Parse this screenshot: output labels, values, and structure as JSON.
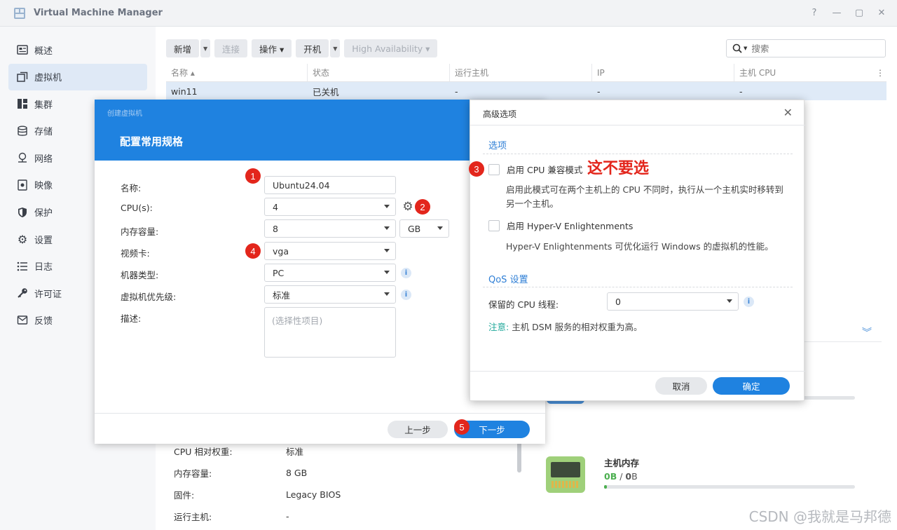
{
  "window": {
    "title": "Virtual Machine Manager",
    "controls": {
      "help": "?",
      "minimize": "—",
      "maximize": "▢",
      "close": "✕"
    }
  },
  "sidebar": {
    "items": [
      {
        "label": "概述",
        "icon": "overview-icon"
      },
      {
        "label": "虚拟机",
        "icon": "vm-icon",
        "active": true
      },
      {
        "label": "集群",
        "icon": "cluster-icon"
      },
      {
        "label": "存储",
        "icon": "storage-icon"
      },
      {
        "label": "网络",
        "icon": "network-icon"
      },
      {
        "label": "映像",
        "icon": "image-icon"
      },
      {
        "label": "保护",
        "icon": "shield-icon"
      },
      {
        "label": "设置",
        "icon": "gear-icon"
      },
      {
        "label": "日志",
        "icon": "log-icon"
      },
      {
        "label": "许可证",
        "icon": "key-icon"
      },
      {
        "label": "反馈",
        "icon": "feedback-icon"
      }
    ]
  },
  "toolbar": {
    "add": "新增",
    "connect": "连接",
    "action": "操作 ▾",
    "power_on": "开机",
    "high_availability": "High Availability ▾",
    "search_placeholder": "搜索",
    "search_value": ""
  },
  "table": {
    "headers": [
      "名称 ▴",
      "状态",
      "运行主机",
      "IP",
      "主机 CPU"
    ],
    "rows": [
      [
        "win11",
        "已关机",
        "-",
        "-",
        "-"
      ]
    ]
  },
  "details": {
    "rows": [
      {
        "label": "CPU 相对权重:",
        "value": "标准"
      },
      {
        "label": "内存容量:",
        "value": "8 GB"
      },
      {
        "label": "固件:",
        "value": "Legacy BIOS"
      },
      {
        "label": "运行主机:",
        "value": "-"
      }
    ]
  },
  "host_memory": {
    "title": "主机内存",
    "used": "0",
    "used_unit": "B",
    "total": "0",
    "total_unit": "B",
    "usage_fraction": 0.0
  },
  "watermark": "CSDN @我就是马邦德",
  "wizard": {
    "small_title": "创建虚拟机",
    "title": "配置常用规格",
    "fields": {
      "name_label": "名称:",
      "name_value": "Ubuntu24.04",
      "cpu_label": "CPU(s):",
      "cpu_value": "4",
      "memory_label": "内存容量:",
      "memory_value": "8",
      "memory_unit": "GB",
      "video_label": "视频卡:",
      "video_value": "vga",
      "machine_label": "机器类型:",
      "machine_value": "PC",
      "priority_label": "虚拟机优先级:",
      "priority_value": "标准",
      "desc_label": "描述:",
      "desc_placeholder": "(选择性项目)"
    },
    "prev": "上一步",
    "next": "下一步",
    "badges": [
      "1",
      "2",
      "4",
      "5"
    ]
  },
  "advanced": {
    "title": "高级选项",
    "options_section": "选项",
    "cpu_compat_label": "启用 CPU 兼容模式",
    "cpu_compat_desc": "启用此模式可在两个主机上的 CPU 不同时，执行从一个主机实时移转到另一个主机。",
    "red_note": "这不要选",
    "hyperv_label": "启用 Hyper-V Enlightenments",
    "hyperv_desc": "Hyper-V Enlightenments 可优化运行 Windows 的虚拟机的性能。",
    "qos_section": "QoS 设置",
    "reserved_cpu_label": "保留的 CPU 线程:",
    "reserved_cpu_value": "0",
    "note_prefix": "注意:",
    "note_text": "主机 DSM 服务的相对权重为高。",
    "cancel": "取消",
    "ok": "确定",
    "badge": "3"
  },
  "colors": {
    "accent": "#1f82e0",
    "badge_red": "#e3261c",
    "success_green": "#4caf50"
  }
}
